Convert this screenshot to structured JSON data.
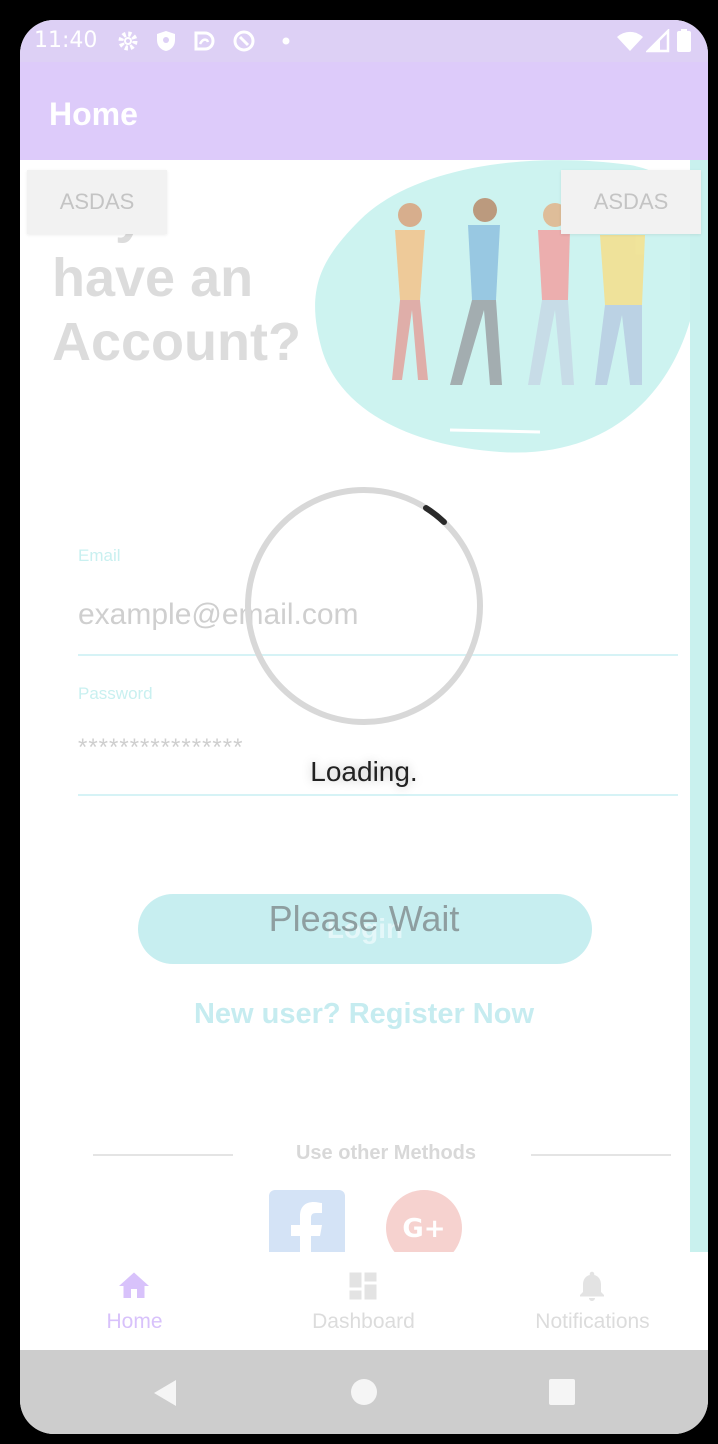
{
  "status_bar": {
    "time": "11:40",
    "icons_left": [
      "gear-icon",
      "shield-icon",
      "sync-icon",
      "at-icon",
      "dot-icon"
    ],
    "icons_right": [
      "wifi-icon",
      "signal-icon",
      "battery-icon"
    ]
  },
  "app_bar": {
    "title": "Home"
  },
  "content": {
    "corner_buttons": [
      "ASDAS",
      "ASDAS"
    ],
    "heading_lines": [
      "ady",
      "have an",
      "Account?"
    ],
    "email": {
      "label": "Email",
      "value": "example@email.com"
    },
    "password": {
      "label": "Password",
      "value": "****************"
    },
    "login_label": "Login",
    "register_text": "New user? Register Now",
    "other_methods_text": "Use other Methods",
    "social": [
      "facebook-icon",
      "google-plus-icon"
    ]
  },
  "overlay": {
    "loading_text": "Loading.",
    "wait_text": "Please Wait"
  },
  "bottom_nav": {
    "items": [
      {
        "label": "Home",
        "icon": "home-icon",
        "active": true
      },
      {
        "label": "Dashboard",
        "icon": "dashboard-icon",
        "active": false
      },
      {
        "label": "Notifications",
        "icon": "bell-icon",
        "active": false
      }
    ]
  },
  "system_nav": [
    "back-icon",
    "home-circle-icon",
    "recents-icon"
  ],
  "colors": {
    "app_bar": "#ddcbfa",
    "accent_teal": "#c9f1ee",
    "active_nav": "#d8c2fb"
  }
}
